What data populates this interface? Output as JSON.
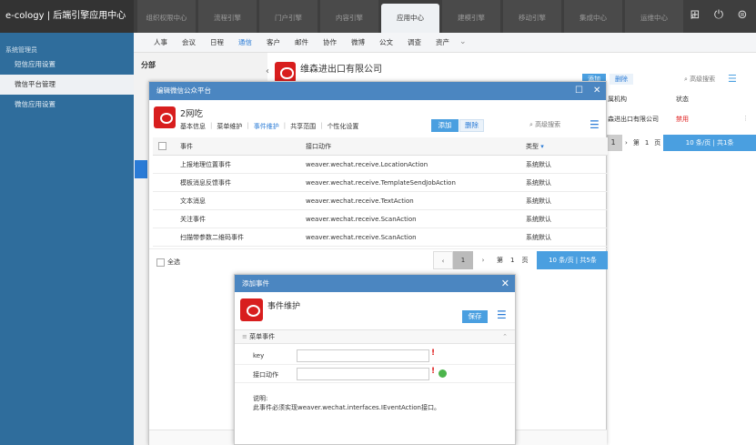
{
  "header": {
    "brand": "e-cology | 后端引擎应用中心",
    "nav": [
      "组织权限中心",
      "流程引擎",
      "门户引擎",
      "内容引擎",
      "应用中心",
      "建模引擎",
      "移动引擎",
      "集成中心",
      "运维中心"
    ],
    "active_nav": "应用中心",
    "more_icon": "chevron-right-icon",
    "icons": [
      "grid-icon",
      "power-icon",
      "menu-icon"
    ]
  },
  "sidebar": {
    "title": "系统管理员",
    "items": [
      "短信应用设置",
      "微信平台管理",
      "微信应用设置"
    ],
    "active": "微信平台管理"
  },
  "subnav": {
    "items": [
      "人事",
      "会议",
      "日程",
      "通信",
      "客户",
      "邮件",
      "协作",
      "微博",
      "公文",
      "调查",
      "资产"
    ],
    "active": "通信"
  },
  "background": {
    "tree_title": "分部",
    "company": "维森进出口有限公司",
    "add": "添加",
    "delete": "删除",
    "search": "高级搜索",
    "col_org": "属机构",
    "col_status": "状态",
    "org_value": "森进出口有限公司",
    "status_value": "禁用",
    "page": "1",
    "pager_text": "第",
    "page_total": "1",
    "pager_unit": "页",
    "pager_size": "10 条/页 | 共1条"
  },
  "dialog1": {
    "title": "编辑微信公众平台",
    "app_name": "2网吃",
    "tabs": [
      "基本信息",
      "菜单维护",
      "事件维护",
      "共享范围",
      "个性化设置"
    ],
    "active_tab": "事件维护",
    "add": "添加",
    "delete": "删除",
    "search": "高级搜索",
    "columns": {
      "event": "事件",
      "action": "接口动作",
      "type": "类型"
    },
    "rows": [
      {
        "event": "上报地理位置事件",
        "action": "weaver.wechat.receive.LocationAction",
        "type": "系统默认"
      },
      {
        "event": "模板消息反馈事件",
        "action": "weaver.wechat.receive.TemplateSendJobAction",
        "type": "系统默认"
      },
      {
        "event": "文本消息",
        "action": "weaver.wechat.receive.TextAction",
        "type": "系统默认"
      },
      {
        "event": "关注事件",
        "action": "weaver.wechat.receive.ScanAction",
        "type": "系统默认"
      },
      {
        "event": "扫描带参数二维码事件",
        "action": "weaver.wechat.receive.ScanAction",
        "type": "系统默认"
      }
    ],
    "select_all": "全选",
    "pager": {
      "current": "1",
      "prefix": "第",
      "page": "1",
      "suffix": "页",
      "size": "10 条/页 | 共5条"
    }
  },
  "dialog2": {
    "title": "添加事件",
    "heading": "事件维护",
    "save": "保存",
    "section": "菜单事件",
    "fields": {
      "key": "key",
      "action": "接口动作"
    },
    "note_label": "说明:",
    "note_text": "此事件必须实现weaver.wechat.interfaces.IEventAction接口。"
  },
  "colors": {
    "header": "#3e3e3e",
    "sidebar": "#2f6d9c",
    "dialog_header": "#4b86c1",
    "accent": "#4a9fe0",
    "danger": "#e02020"
  }
}
